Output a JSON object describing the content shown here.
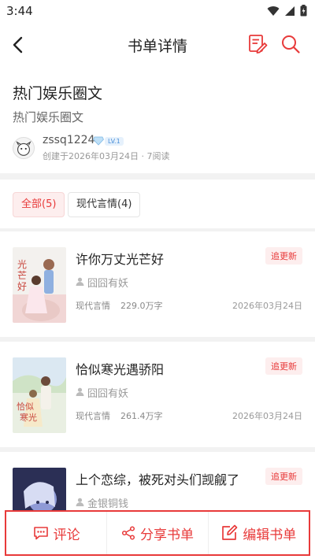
{
  "status": {
    "time": "3:44"
  },
  "nav": {
    "title": "书单详情"
  },
  "booklist": {
    "title": "热门娱乐圈文",
    "subtitle": "热门娱乐圈文",
    "user": "zssq1224",
    "level": "LV.1",
    "meta": "创建于2026年03月24日 · 7阅读"
  },
  "filters": [
    {
      "label": "全部(5)",
      "active": true
    },
    {
      "label": "现代言情(4)",
      "active": false
    }
  ],
  "books": [
    {
      "title": "许你万丈光芒好",
      "author": "囧囧有妖",
      "category": "现代言情",
      "words": "229.0万字",
      "date": "2026年03月24日",
      "badge": "追更新",
      "cover_colors": [
        "#f3f1ee",
        "#e9c9c6"
      ]
    },
    {
      "title": "恰似寒光遇骄阳",
      "author": "囧囧有妖",
      "category": "现代言情",
      "words": "261.4万字",
      "date": "2026年03月24日",
      "badge": "追更新",
      "cover_colors": [
        "#e9efe2",
        "#d8c98e"
      ]
    },
    {
      "title": "上个恋综，被死对头们觊觎了",
      "author": "金银铜钱",
      "category": "",
      "words": "",
      "date": "",
      "badge": "追更新",
      "cover_colors": [
        "#2b2f55",
        "#8f9ad6"
      ]
    }
  ],
  "actions": {
    "comment": "评论",
    "share": "分享书单",
    "edit": "编辑书单"
  },
  "colors": {
    "accent": "#e83a3a"
  }
}
